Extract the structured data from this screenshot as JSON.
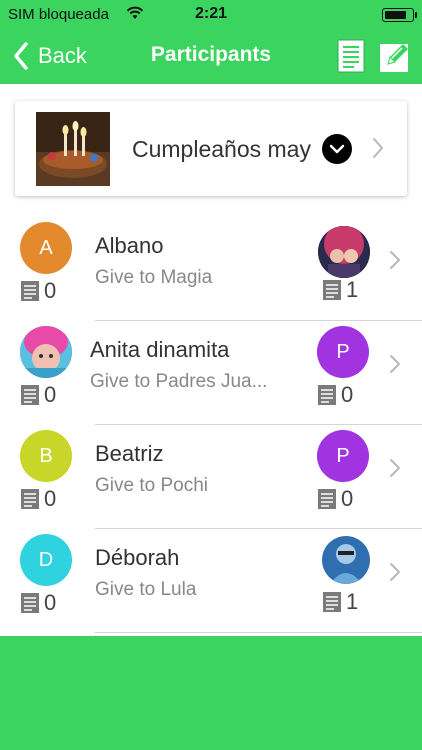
{
  "status_bar": {
    "carrier": "SIM bloqueada",
    "time": "2:21"
  },
  "nav": {
    "back_label": "Back",
    "title": "Participants"
  },
  "event": {
    "name": "Cumpleaños mayo"
  },
  "participants": [
    {
      "name": "Albano",
      "initial": "A",
      "color": "#e38a2f",
      "gives": "Give to Magia",
      "count": "0",
      "recipient": {
        "initial": "",
        "color": "#8a2f49",
        "photo": true
      },
      "recipient_count": "1"
    },
    {
      "name": "Anita dinamita",
      "initial": "",
      "color": "#d94e9a",
      "photo": true,
      "gives": "Give to Padres Jua...",
      "count": "0",
      "recipient": {
        "initial": "P",
        "color": "#a134e0"
      },
      "recipient_count": "0"
    },
    {
      "name": "Beatriz",
      "initial": "B",
      "color": "#c8d62a",
      "gives": "Give to Pochi",
      "count": "0",
      "recipient": {
        "initial": "P",
        "color": "#a134e0"
      },
      "recipient_count": "0"
    },
    {
      "name": "Déborah",
      "initial": "D",
      "color": "#2fd3df",
      "gives": "Give to Lula",
      "count": "0",
      "recipient": {
        "initial": "",
        "color": "#3a6fb0",
        "photo": true
      },
      "recipient_count": "1"
    }
  ]
}
